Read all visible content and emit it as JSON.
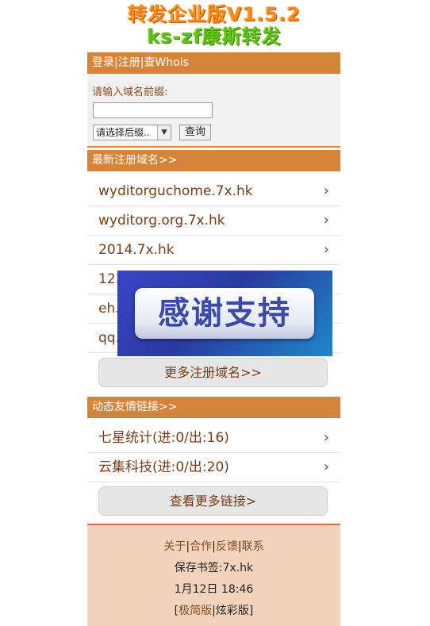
{
  "logo": {
    "line1": "转发企业版V1.5.2",
    "line2": "ks-zf康斯转发"
  },
  "nav": {
    "login": "登录",
    "sep1": "|",
    "register": "注册",
    "sep2": "|",
    "whois": "查Whois"
  },
  "search": {
    "label": "请输入域名前缀:",
    "input_value": "",
    "suffix_selected": "请选择后缀..",
    "query_button": "查询"
  },
  "latest_domains": {
    "header": "最新注册域名>>",
    "items": [
      "wyditorguchome.7x.hk",
      "wyditorg.org.7x.hk",
      "2014.7x.hk",
      "123",
      "eh.",
      "qq."
    ],
    "more_button": "更多注册域名>>"
  },
  "friend_links": {
    "header": "动态友情链接>>",
    "items": [
      "七星统计(进:0/出:16)",
      "云集科技(进:0/出:20)"
    ],
    "more_button": "查看更多链接>"
  },
  "footer": {
    "about": "关于",
    "cooperate": "合作",
    "feedback": "反馈",
    "contact": "联系",
    "sep": "|",
    "bookmark": "保存书签:7x.hk",
    "datetime": "1月12日 18:46",
    "bracket_open": "[",
    "simple": "极简版",
    "fancy": "炫彩版",
    "bracket_close": "]"
  },
  "banner": {
    "text": "感谢支持"
  },
  "chevron": "›",
  "colors": {
    "accent_bar": "#d6843a",
    "link_text": "#7a3c17",
    "footer_bg": "#f2d3bb"
  }
}
